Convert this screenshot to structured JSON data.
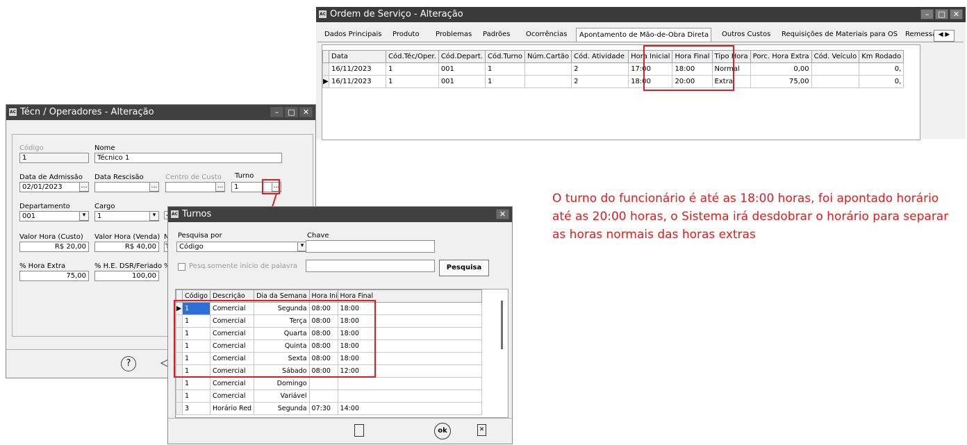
{
  "ordem": {
    "title": "Ordem de Serviço - Alteração",
    "tabs": [
      "Dados Principais",
      "Produto",
      "Problemas",
      "Padrões",
      "Ocorrências",
      "Apontamento de Mão-de-Obra Direta",
      "Outros Custos",
      "Requisições de Materiais para OS",
      "Remessa"
    ],
    "columns": [
      "Data",
      "Cód.Téc/Oper.",
      "Cód.Depart.",
      "Cód.Turno",
      "Núm.Cartão",
      "Cód. Atividade",
      "Hora Inicial",
      "Hora Final",
      "Tipo Hora",
      "Porc. Hora Extra",
      "Cód. Veículo",
      "Km Rodado"
    ],
    "rows": [
      [
        "16/11/2023",
        "1",
        "001",
        "1",
        "",
        "2",
        "17:00",
        "18:00",
        "Normal",
        "0,00",
        "",
        "0,"
      ],
      [
        "16/11/2023",
        "1",
        "001",
        "1",
        "",
        "2",
        "18:00",
        "20:00",
        "Extra",
        "75,00",
        "",
        "0,"
      ]
    ]
  },
  "tecnico": {
    "title": "Técn / Operadores - Alteração",
    "codigo_label": "Código",
    "codigo": "1",
    "nome_label": "Nome",
    "nome": "Técnico 1",
    "admissao_label": "Data de Admissão",
    "admissao": "02/01/2023",
    "rescisao_label": "Data Rescisão",
    "rescisao": "",
    "centro_label": "Centro de Custo",
    "centro": "",
    "turno_label": "Turno",
    "turno": "1",
    "depto_label": "Departamento",
    "depto": "001",
    "cargo_label": "Cargo",
    "cargo": "1",
    "vh_custo_label": "Valor Hora (Custo)",
    "vh_custo": "R$ 20,00",
    "vh_venda_label": "Valor Hora (Venda)",
    "vh_venda": "R$ 40,00",
    "no_label": "No",
    "no_value": "TE",
    "he_label": "% Hora Extra",
    "he": "75,00",
    "he_dsr_label": "% H.E. DSR/Feriado",
    "he_dsr": "100,00",
    "pct_label": "%"
  },
  "turnos": {
    "title": "Turnos",
    "pesquisa_label": "Pesquisa por",
    "pesquisa_value": "Código",
    "chave_label": "Chave",
    "chave": "",
    "pesq_check_label": "Pesq.somente início de palavra",
    "pesquisa_button": "Pesquisa",
    "columns": [
      "Código",
      "Descrição",
      "Dia da Semana",
      "Hora Inicial",
      "Hora Final"
    ],
    "rows": [
      [
        "1",
        "Comercial",
        "Segunda",
        "08:00",
        "18:00"
      ],
      [
        "1",
        "Comercial",
        "Terça",
        "08:00",
        "18:00"
      ],
      [
        "1",
        "Comercial",
        "Quarta",
        "08:00",
        "18:00"
      ],
      [
        "1",
        "Comercial",
        "Quinta",
        "08:00",
        "18:00"
      ],
      [
        "1",
        "Comercial",
        "Sexta",
        "08:00",
        "18:00"
      ],
      [
        "1",
        "Comercial",
        "Sábado",
        "08:00",
        "12:00"
      ],
      [
        "1",
        "Comercial",
        "Domingo",
        "",
        ""
      ],
      [
        "1",
        "Comercial",
        "Variável",
        "",
        ""
      ],
      [
        "3",
        "Horário Red",
        "Segunda",
        "07:30",
        "14:00"
      ]
    ]
  },
  "note": "O turno do funcionário é até as 18:00 horas, foi apontado horário até as 20:00 horas, o Sistema irá desdobrar o horário para separar as horas normais das horas extras"
}
